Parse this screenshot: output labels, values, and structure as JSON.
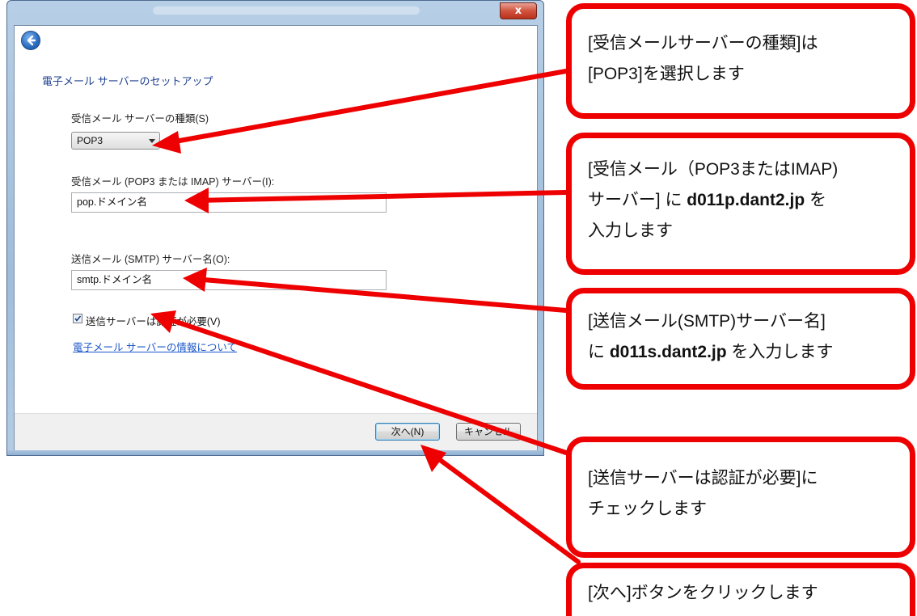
{
  "dialog": {
    "close_label": "x",
    "heading": "電子メール サーバーのセットアップ",
    "incoming_type_label": "受信メール サーバーの種類(S)",
    "incoming_type_value": "POP3",
    "incoming_server_label": "受信メール (POP3 または IMAP) サーバー(I):",
    "incoming_server_value": "pop.ドメイン名",
    "outgoing_server_label": "送信メール (SMTP) サーバー名(O):",
    "outgoing_server_value": "smtp.ドメイン名",
    "auth_checkbox_label": "送信サーバーは認証が必要(V)",
    "auth_checked": true,
    "info_link": "電子メール サーバーの情報について",
    "next_button": "次へ(N)",
    "cancel_button": "キャンセル"
  },
  "callouts": {
    "c1": {
      "line1": "[受信メールサーバーの種類]は",
      "line2": "[POP3]を選択します"
    },
    "c2": {
      "line1": "[受信メール（POP3またはIMAP)",
      "line2_pre": "サーバー] に ",
      "line2_bold": "d011p.dant2.jp",
      "line2_post": " を",
      "line3": "入力します"
    },
    "c3": {
      "line1": "[送信メール(SMTP)サーバー名]",
      "line2_pre": "に ",
      "line2_bold": "d011s.dant2.jp",
      "line2_post": " を入力します"
    },
    "c4": {
      "line1": "[送信サーバーは認証が必要]に",
      "line2": "チェックします"
    },
    "c5": {
      "line1": "[次へ]ボタンをクリックします"
    }
  },
  "colors": {
    "callout_border": "#ee0000",
    "arrow": "#ee0000",
    "heading_text": "#1e3f8e",
    "link_text": "#1a56c9"
  }
}
